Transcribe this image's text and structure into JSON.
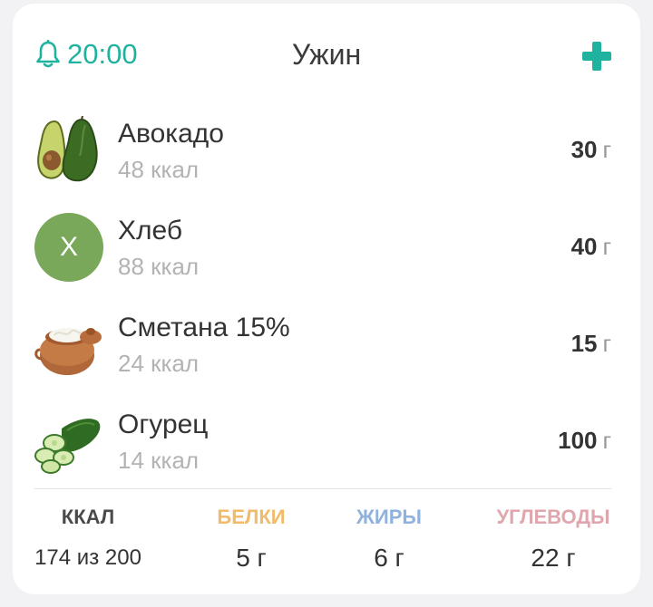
{
  "header": {
    "alarm_time": "20:00",
    "meal_title": "Ужин",
    "alarm_icon": "bell-icon",
    "add_icon": "plus-icon"
  },
  "foods": [
    {
      "name": "Авокадо",
      "kcal": "48 ккал",
      "amount": "30",
      "unit": "г",
      "thumb": "avocado-image"
    },
    {
      "name": "Хлеб",
      "kcal": "88 ккал",
      "amount": "40",
      "unit": "г",
      "thumb": "letter-avatar",
      "avatar_letter": "Х"
    },
    {
      "name": "Сметана 15%",
      "kcal": "24 ккал",
      "amount": "15",
      "unit": "г",
      "thumb": "sour-cream-image"
    },
    {
      "name": "Огурец",
      "kcal": "14 ккал",
      "amount": "100",
      "unit": "г",
      "thumb": "cucumber-image"
    }
  ],
  "totals": {
    "kcal": {
      "label": "ККАЛ",
      "value": "174 из 200",
      "color": "#4a4a4a"
    },
    "protein": {
      "label": "БЕЛКИ",
      "value": "5 г",
      "color": "#f0bb6a"
    },
    "fat": {
      "label": "ЖИРЫ",
      "value": "6 г",
      "color": "#8fb3dc"
    },
    "carbs": {
      "label": "УГЛЕВОДЫ",
      "value": "22 г",
      "color": "#e0a6ad"
    }
  },
  "colors": {
    "accent": "#1fb39f",
    "avatar_bg": "#7aa85a"
  }
}
